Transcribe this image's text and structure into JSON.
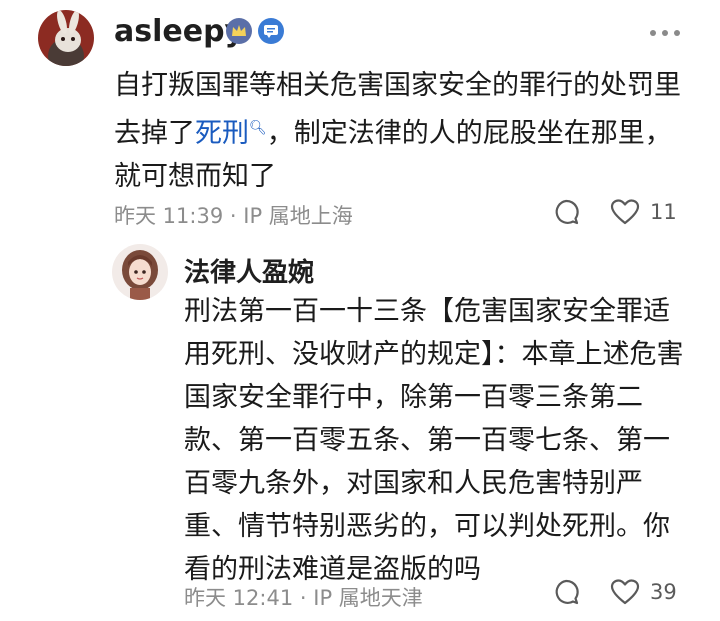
{
  "comments": [
    {
      "username": "asleepy",
      "content_before": "自打叛国罪等相关危害国家安全的罪行的处罚里去掉了",
      "content_link": "死刑",
      "content_after": "，制定法律的人的屁股坐在那里，就可想而知了",
      "time": "昨天 11:39",
      "ip": "IP 属地上海",
      "likes": "11",
      "badges": [
        "crown-badge-icon",
        "message-badge-icon"
      ]
    },
    {
      "username": "法律人盈婉",
      "content": "刑法第一百一十三条【危害国家安全罪适用死刑、没收财产的规定】：本章上述危害国家安全罪行中，除第一百零三条第二款、第一百零五条、第一百零七条、第一百零九条外，对国家和人民危害特别严重、情节特别恶劣的，可以判处死刑。你看的刑法难道是盗版的吗",
      "time": "昨天 12:41",
      "ip": "IP 属地天津",
      "likes": "39"
    }
  ],
  "separator": "·",
  "colors": {
    "link": "#1a5bbf",
    "meta": "#8c8c8c",
    "badge_crown": "#5b6fa8",
    "badge_message": "#3a7bd5"
  }
}
